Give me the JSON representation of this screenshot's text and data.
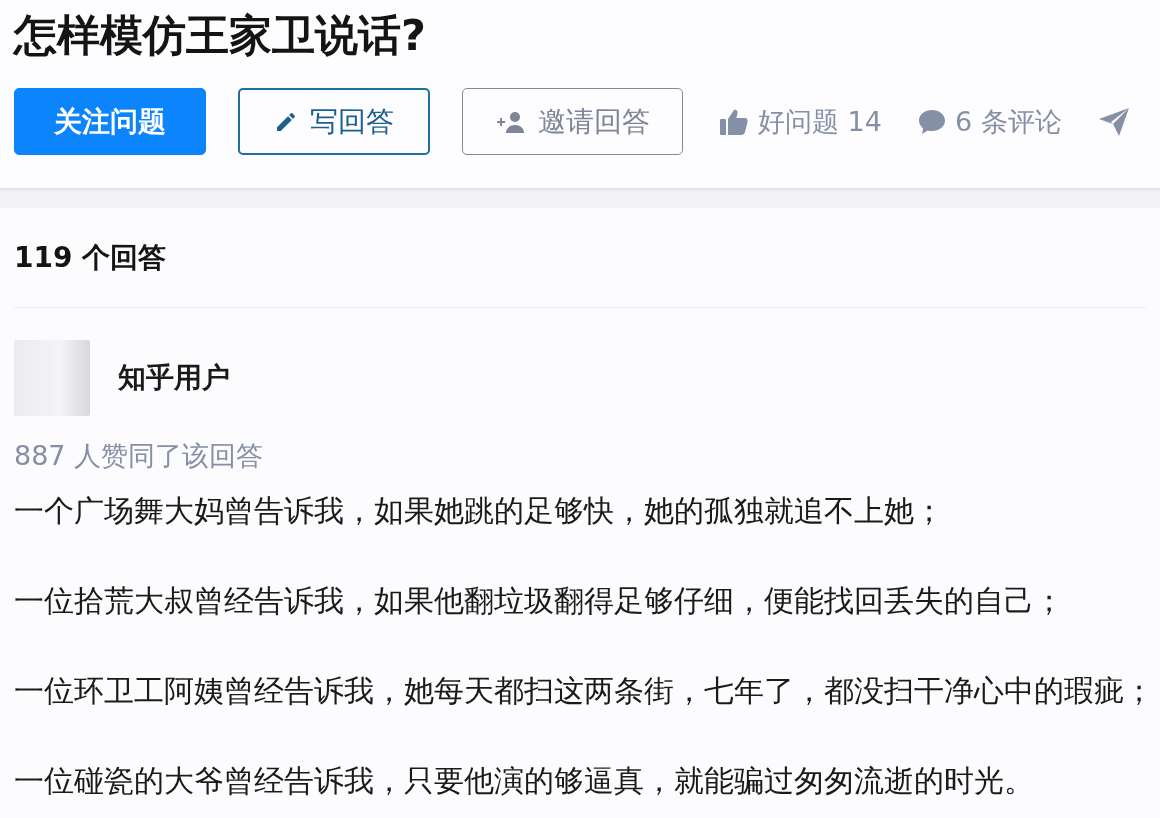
{
  "question": {
    "title": "怎样模仿王家卫说话?"
  },
  "actions": [
    {
      "kind": "primary",
      "label": "关注问题"
    },
    {
      "kind": "outline",
      "label": "写回答"
    },
    {
      "kind": "secondary",
      "label": "邀请回答"
    }
  ],
  "meta": [
    {
      "kind": "like",
      "label": "好问题 14"
    },
    {
      "kind": "comment",
      "label": "6 条评论"
    },
    {
      "kind": "share"
    }
  ],
  "answers_header": {
    "count": "119 个回答"
  },
  "answer": {
    "author": "知乎用户",
    "votes": "887 人赞同了该回答",
    "paragraphs": [
      "一个广场舞大妈曾告诉我，如果她跳的足够快，她的孤独就追不上她；",
      "一位拾荒大叔曾经告诉我，如果他翻垃圾翻得足够仔细，便能找回丢失的自己；",
      "一位环卫工阿姨曾经告诉我，她每天都扫这两条街，七年了，都没扫干净心中的瑕疵；",
      "一位碰瓷的大爷曾经告诉我，只要他演的够逼真，就能骗过匆匆流逝的时光。"
    ]
  }
}
